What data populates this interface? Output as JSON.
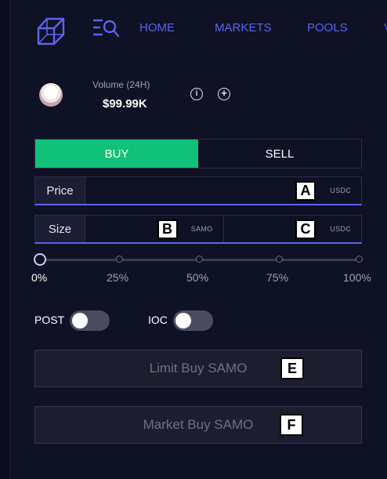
{
  "nav": {
    "items": [
      "HOME",
      "MARKETS",
      "POOLS",
      "V"
    ]
  },
  "market": {
    "volume_label": "Volume (24H)",
    "volume_value": "$99.99K",
    "info_glyph": "i",
    "plus_glyph": "+"
  },
  "order": {
    "buy_label": "BUY",
    "sell_label": "SELL",
    "price_label": "Price",
    "size_label": "Size",
    "price_unit": "USDC",
    "size_unit_base": "SAMO",
    "size_unit_quote": "USDC",
    "slider_value_percent": 0,
    "slider_ticks": [
      "0%",
      "25%",
      "50%",
      "75%",
      "100%"
    ],
    "post_label": "POST",
    "ioc_label": "IOC",
    "post_on": false,
    "ioc_on": false,
    "limit_button": "Limit Buy SAMO",
    "market_button": "Market Buy SAMO"
  },
  "markers": {
    "a": "A",
    "b": "B",
    "c": "C",
    "e": "E",
    "f": "F"
  },
  "colors": {
    "accent": "#5b63f0",
    "buy_green": "#10c17a",
    "background": "#0f1124"
  },
  "icons": {
    "logo": "cube-logo-icon",
    "search": "menu-search-icon",
    "info": "info-icon",
    "add": "plus-circle-icon",
    "coin": "samo-token-icon"
  }
}
